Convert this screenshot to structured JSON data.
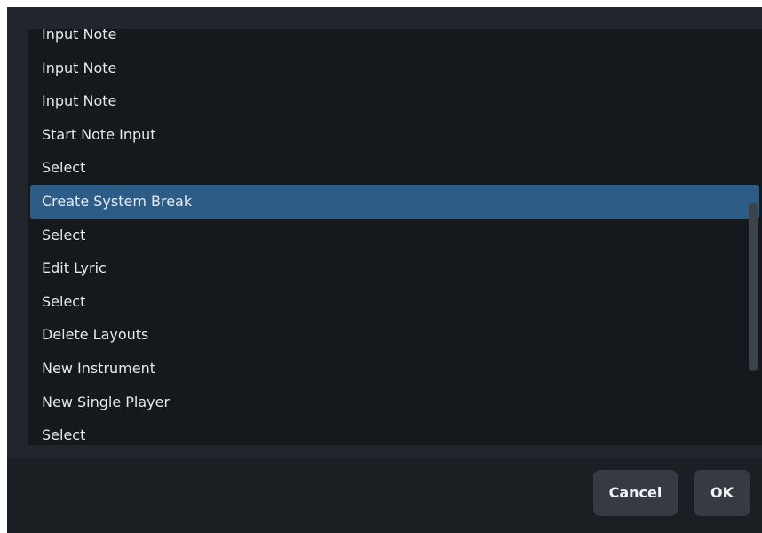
{
  "list": {
    "items": [
      "Input Note",
      "Input Note",
      "Input Note",
      "Start Note Input",
      "Select",
      "Create System Break",
      "Select",
      "Edit Lyric",
      "Select",
      "Delete Layouts",
      "New Instrument",
      "New Single Player",
      "Select"
    ],
    "selected_index": 5
  },
  "buttons": {
    "cancel_label": "Cancel",
    "ok_label": "OK"
  },
  "colors": {
    "background": "#22262c",
    "list_background": "#15181c",
    "selected_row": "#2d5d86",
    "button": "#363b43"
  }
}
